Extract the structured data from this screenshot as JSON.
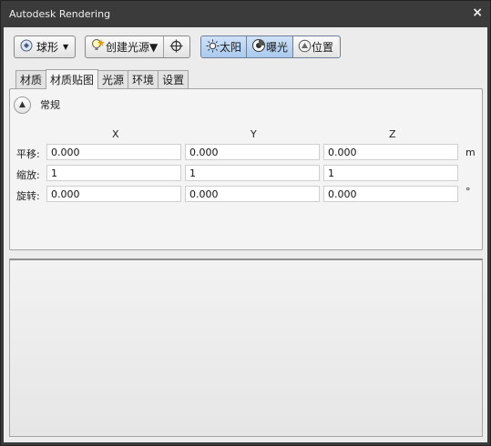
{
  "window": {
    "title": "Autodesk Rendering",
    "close_glyph": "×"
  },
  "toolbar": {
    "sphere_label": "球形",
    "create_light_label": "创建光源",
    "sun_label": "太阳",
    "exposure_label": "曝光",
    "location_label": "位置"
  },
  "tabs": [
    "材质",
    "材质贴图",
    "光源",
    "环境",
    "设置"
  ],
  "active_tab": "材质贴图",
  "section": {
    "title": "常规"
  },
  "columns": {
    "x": "X",
    "y": "Y",
    "z": "Z"
  },
  "rows": [
    {
      "label": "平移:",
      "x": "0.000",
      "y": "0.000",
      "z": "0.000",
      "unit": "m"
    },
    {
      "label": "缩放:",
      "x": "1",
      "y": "1",
      "z": "1",
      "unit": ""
    },
    {
      "label": "旋转:",
      "x": "0.000",
      "y": "0.000",
      "z": "0.000",
      "unit": "°"
    }
  ],
  "colors": {
    "frame": "#3b3b3b",
    "client": "#ececec",
    "toggle_on": "#a9c9ee"
  }
}
